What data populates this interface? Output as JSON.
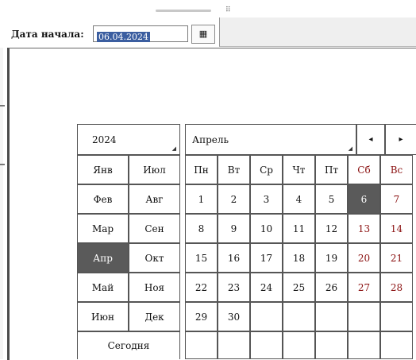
{
  "date_field": {
    "label": "Дата начала:",
    "value": "06.04.2024",
    "button_icon": "calendar-icon",
    "button_glyph": "▦"
  },
  "picker": {
    "year": "2024",
    "month": "Апрель",
    "prev_arrow": "◂",
    "next_arrow": "▸",
    "months": [
      [
        "Янв",
        "Июл"
      ],
      [
        "Фев",
        "Авг"
      ],
      [
        "Мар",
        "Сен"
      ],
      [
        "Апр",
        "Окт"
      ],
      [
        "Май",
        "Ноя"
      ],
      [
        "Июн",
        "Дек"
      ]
    ],
    "selected_month": "Апр",
    "today_label": "Сегодня",
    "weekdays": [
      "Пн",
      "Вт",
      "Ср",
      "Чт",
      "Пт",
      "Сб",
      "Вс"
    ],
    "weeks": [
      [
        "1",
        "2",
        "3",
        "4",
        "5",
        "6",
        "7"
      ],
      [
        "8",
        "9",
        "10",
        "11",
        "12",
        "13",
        "14"
      ],
      [
        "15",
        "16",
        "17",
        "18",
        "19",
        "20",
        "21"
      ],
      [
        "22",
        "23",
        "24",
        "25",
        "26",
        "27",
        "28"
      ],
      [
        "29",
        "30",
        "",
        "",
        "",
        "",
        ""
      ],
      [
        "",
        "",
        "",
        "",
        "",
        "",
        ""
      ]
    ],
    "selected_day": "6"
  },
  "colors": {
    "selected_bg": "#5a5a5a",
    "weekend_text": "#8a1010",
    "input_highlight": "#3b5ea0"
  }
}
